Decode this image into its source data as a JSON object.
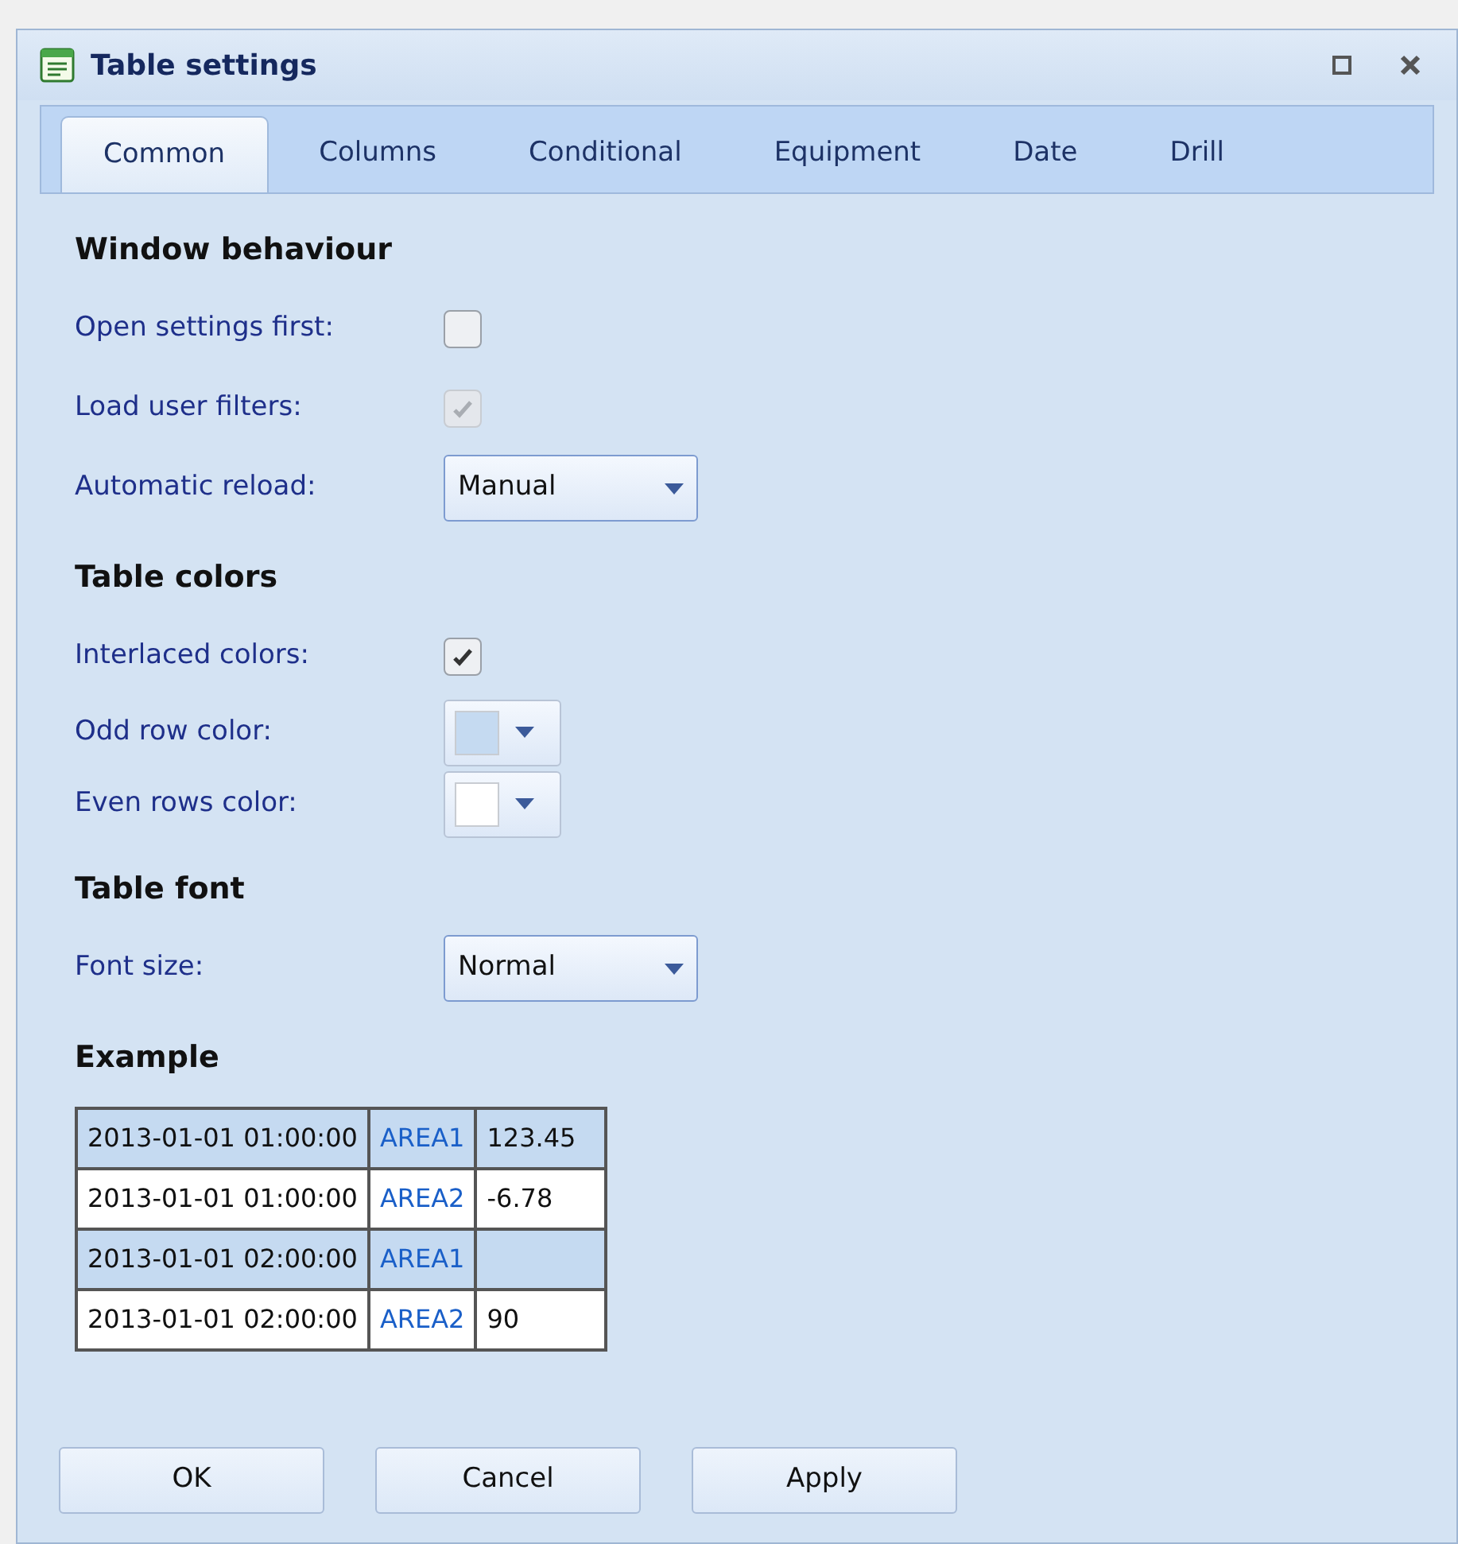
{
  "window": {
    "title": "Table settings"
  },
  "tabs": [
    {
      "label": "Common",
      "selected": true
    },
    {
      "label": "Columns",
      "selected": false
    },
    {
      "label": "Conditional",
      "selected": false
    },
    {
      "label": "Equipment",
      "selected": false
    },
    {
      "label": "Date",
      "selected": false
    },
    {
      "label": "Drill",
      "selected": false
    }
  ],
  "sections": [
    {
      "heading": "Window behaviour",
      "rows": [
        {
          "kind": "checkbox",
          "label": "Open settings first:",
          "checked": false,
          "disabled": false
        },
        {
          "kind": "checkbox",
          "label": "Load user filters:",
          "checked": true,
          "disabled": true
        },
        {
          "kind": "dropdown",
          "label": "Automatic reload:",
          "value": "Manual"
        }
      ]
    },
    {
      "heading": "Table colors",
      "rows": [
        {
          "kind": "checkbox",
          "label": "Interlaced colors:",
          "checked": true,
          "disabled": false
        },
        {
          "kind": "color",
          "label": "Odd row color:",
          "color": "#c5daf1"
        },
        {
          "kind": "color",
          "label": "Even rows color:",
          "color": "#ffffff"
        }
      ]
    },
    {
      "heading": "Table font",
      "rows": [
        {
          "kind": "dropdown",
          "label": "Font size:",
          "value": "Normal"
        }
      ]
    }
  ],
  "example": {
    "heading": "Example",
    "rows": [
      [
        "2013-01-01 01:00:00",
        "AREA1",
        "123.45"
      ],
      [
        "2013-01-01 01:00:00",
        "AREA2",
        "-6.78"
      ],
      [
        "2013-01-01 02:00:00",
        "AREA1",
        null
      ],
      [
        "2013-01-01 02:00:00",
        "AREA2",
        "90"
      ]
    ]
  },
  "buttons": [
    "OK",
    "Cancel",
    "Apply"
  ]
}
